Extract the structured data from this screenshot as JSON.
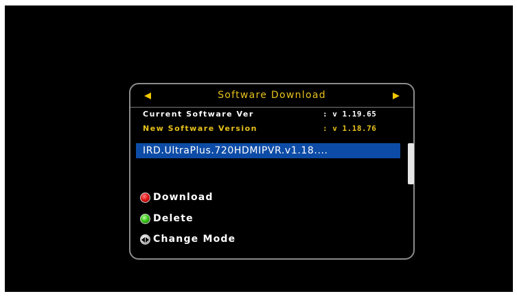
{
  "dialog": {
    "title": "Software Download",
    "current_version_label": "Current Software Ver",
    "current_version_value": ": v 1.19.65",
    "new_version_label": "New Software Version",
    "new_version_value": ": v 1.18.76"
  },
  "file_list": {
    "items": [
      {
        "name": "IRD.UltraPlus.720HDMIPVR.v1.18....",
        "selected": true
      }
    ]
  },
  "actions": {
    "download_label": "Download",
    "delete_label": "Delete",
    "change_mode_label": "Change Mode"
  },
  "colors": {
    "title": "#e8c21c",
    "arrow": "#f2c800",
    "selection": "#0d4ca6",
    "background": "#000000",
    "border": "#8c8c8c"
  },
  "icons": {
    "prev": "arrow-left-icon",
    "next": "arrow-right-icon",
    "download": "red-button-icon",
    "delete": "green-button-icon",
    "change_mode": "left-right-nav-button-icon"
  }
}
